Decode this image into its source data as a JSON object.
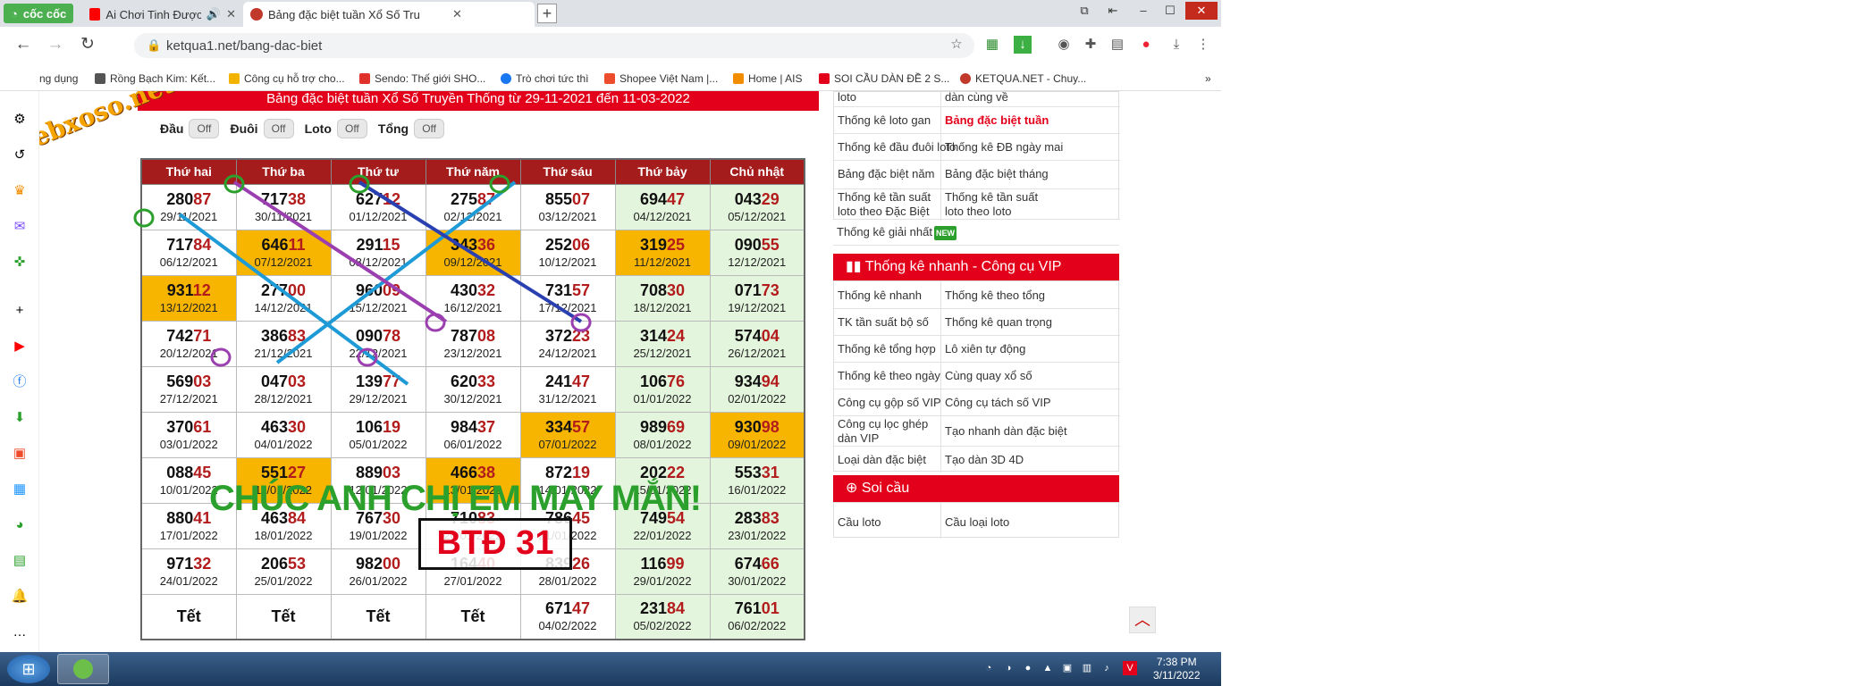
{
  "browser": {
    "brand": "cốc cốc",
    "tabs": [
      {
        "title": "Ai Chơi Tinh Được Mãi",
        "active": false
      },
      {
        "title": "Bảng đặc biệt tuần Xổ Số Tru",
        "active": true
      }
    ],
    "url": "ketqua1.net/bang-dac-biet",
    "bookmarks": [
      "ng dụng",
      "Rồng Bạch Kim: Kết...",
      "Công cụ hỗ trợ cho...",
      "Sendo: Thế giới SHO...",
      "Trò chơi tức thì",
      "Shopee Việt Nam |...",
      "Home | AIS",
      "SOI CẦU DÀN ĐỀ 2 S...",
      "KETQUA.NET - Chuy..."
    ]
  },
  "page": {
    "heading": "Bảng đặc biệt tuần Xổ Số Truyền Thống từ 29-11-2021 đến 11-03-2022",
    "toggles": [
      {
        "label": "Đầu",
        "state": "Off"
      },
      {
        "label": "Đuôi",
        "state": "Off"
      },
      {
        "label": "Loto",
        "state": "Off"
      },
      {
        "label": "Tổng",
        "state": "Off"
      }
    ],
    "weekdays": [
      "Thứ hai",
      "Thứ ba",
      "Thứ tư",
      "Thứ năm",
      "Thứ sáu",
      "Thứ bảy",
      "Chủ nhật"
    ],
    "rows": [
      [
        [
          "280",
          "87",
          "29/11/2021"
        ],
        [
          "717",
          "38",
          "30/11/2021"
        ],
        [
          "627",
          "12",
          "01/12/2021"
        ],
        [
          "275",
          "87",
          "02/12/2021"
        ],
        [
          "855",
          "07",
          "03/12/2021"
        ],
        [
          "694",
          "47",
          "04/12/2021"
        ],
        [
          "043",
          "29",
          "05/12/2021"
        ]
      ],
      [
        [
          "717",
          "84",
          "06/12/2021"
        ],
        [
          "646",
          "11",
          "07/12/2021"
        ],
        [
          "291",
          "15",
          "08/12/2021"
        ],
        [
          "343",
          "36",
          "09/12/2021"
        ],
        [
          "252",
          "06",
          "10/12/2021"
        ],
        [
          "319",
          "25",
          "11/12/2021"
        ],
        [
          "090",
          "55",
          "12/12/2021"
        ]
      ],
      [
        [
          "931",
          "12",
          "13/12/2021"
        ],
        [
          "277",
          "00",
          "14/12/2021"
        ],
        [
          "960",
          "09",
          "15/12/2021"
        ],
        [
          "430",
          "32",
          "16/12/2021"
        ],
        [
          "731",
          "57",
          "17/12/2021"
        ],
        [
          "708",
          "30",
          "18/12/2021"
        ],
        [
          "071",
          "73",
          "19/12/2021"
        ]
      ],
      [
        [
          "742",
          "71",
          "20/12/2021"
        ],
        [
          "386",
          "83",
          "21/12/2021"
        ],
        [
          "090",
          "78",
          "22/12/2021"
        ],
        [
          "787",
          "08",
          "23/12/2021"
        ],
        [
          "372",
          "23",
          "24/12/2021"
        ],
        [
          "314",
          "24",
          "25/12/2021"
        ],
        [
          "574",
          "04",
          "26/12/2021"
        ]
      ],
      [
        [
          "569",
          "03",
          "27/12/2021"
        ],
        [
          "047",
          "03",
          "28/12/2021"
        ],
        [
          "139",
          "77",
          "29/12/2021"
        ],
        [
          "620",
          "33",
          "30/12/2021"
        ],
        [
          "241",
          "47",
          "31/12/2021"
        ],
        [
          "106",
          "76",
          "01/01/2022"
        ],
        [
          "934",
          "94",
          "02/01/2022"
        ]
      ],
      [
        [
          "370",
          "61",
          "03/01/2022"
        ],
        [
          "463",
          "30",
          "04/01/2022"
        ],
        [
          "106",
          "19",
          "05/01/2022"
        ],
        [
          "984",
          "37",
          "06/01/2022"
        ],
        [
          "334",
          "57",
          "07/01/2022"
        ],
        [
          "989",
          "69",
          "08/01/2022"
        ],
        [
          "930",
          "98",
          "09/01/2022"
        ]
      ],
      [
        [
          "088",
          "45",
          "10/01/2022"
        ],
        [
          "551",
          "27",
          "11/01/2022"
        ],
        [
          "889",
          "03",
          "12/01/2022"
        ],
        [
          "466",
          "38",
          "13/01/2022"
        ],
        [
          "872",
          "19",
          "14/01/2022"
        ],
        [
          "202",
          "22",
          "15/01/2022"
        ],
        [
          "553",
          "31",
          "16/01/2022"
        ]
      ],
      [
        [
          "880",
          "41",
          "17/01/2022"
        ],
        [
          "463",
          "84",
          "18/01/2022"
        ],
        [
          "767",
          "30",
          "19/01/2022"
        ],
        [
          "710",
          "83",
          "20/01/2022"
        ],
        [
          "786",
          "45",
          "21/01/2022"
        ],
        [
          "749",
          "54",
          "22/01/2022"
        ],
        [
          "283",
          "83",
          "23/01/2022"
        ]
      ],
      [
        [
          "971",
          "32",
          "24/01/2022"
        ],
        [
          "206",
          "53",
          "25/01/2022"
        ],
        [
          "982",
          "00",
          "26/01/2022"
        ],
        [
          "164",
          "40",
          "27/01/2022"
        ],
        [
          "839",
          "26",
          "28/01/2022"
        ],
        [
          "116",
          "99",
          "29/01/2022"
        ],
        [
          "674",
          "66",
          "30/01/2022"
        ]
      ],
      [
        [
          "Tết",
          "",
          ""
        ],
        [
          "Tết",
          "",
          ""
        ],
        [
          "Tết",
          "",
          ""
        ],
        [
          "Tết",
          "",
          ""
        ],
        [
          "671",
          "47",
          "04/02/2022"
        ],
        [
          "231",
          "84",
          "05/02/2022"
        ],
        [
          "761",
          "01",
          "06/02/2022"
        ]
      ]
    ],
    "watermark": "CHÚC ANH CHỊ EM MAY MẮN!",
    "box_label": "BTĐ 31",
    "site_stamp": "webxoso.net"
  },
  "right_panel": {
    "top_links": [
      [
        "loto",
        "dàn cùng về"
      ],
      [
        "Thống kê loto gan",
        "Bảng đặc biệt tuần"
      ],
      [
        "Thống kê đầu đuôi loto",
        "Thống kê ĐB ngày mai"
      ],
      [
        "Bảng đặc biệt năm",
        "Bảng đặc biệt tháng"
      ],
      [
        "Thống kê tần suất loto theo Đặc Biệt",
        "Thống kê tần suất loto theo loto"
      ],
      [
        "Thống kê giải nhất",
        ""
      ]
    ],
    "new_badge": "NEW",
    "section1_title": "Thống kê nhanh - Công cụ VIP",
    "section1_links": [
      [
        "Thống kê nhanh",
        "Thống kê theo tổng"
      ],
      [
        "TK tần suất bộ số",
        "Thống kê quan trọng"
      ],
      [
        "Thống kê tổng hợp",
        "Lô xiên tự động"
      ],
      [
        "Thống kê theo ngày",
        "Cùng quay xổ số"
      ],
      [
        "Công cụ gộp số VIP",
        "Công cụ tách số VIP"
      ],
      [
        "Công cụ lọc ghép dàn VIP",
        "Tạo nhanh dàn đặc biệt"
      ],
      [
        "Loại dàn đặc biệt",
        "Tạo dàn 3D 4D"
      ]
    ],
    "section2_title": "Soi cầu",
    "section2_links": [
      [
        "Cầu loto",
        "Cầu loại loto"
      ]
    ]
  },
  "taskbar": {
    "time": "7:38 PM",
    "date": "3/11/2022"
  },
  "colors": {
    "header_red": "#a51c1c",
    "accent_red": "#e3001b",
    "highlight": "#f7b500",
    "weekend": "#e4f5dd",
    "watermark_green": "#2ca02c"
  }
}
